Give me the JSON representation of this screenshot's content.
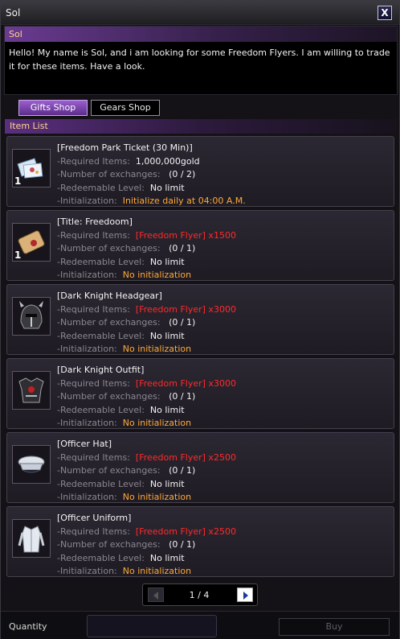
{
  "window": {
    "title": "Sol",
    "close_label": "X"
  },
  "npc": {
    "name": "Sol",
    "dialogue": "Hello! My name is Sol, and i am looking for some Freedom Flyers. I am willing to trade it for these items. Have a look."
  },
  "tabs": [
    {
      "label": "Gifts Shop",
      "active": true
    },
    {
      "label": "Gears Shop",
      "active": false
    }
  ],
  "item_list_header": "Item List",
  "field_labels": {
    "required": "-Required Items:",
    "exchanges": "-Number of exchanges:",
    "level": "-Redeemable Level:",
    "init": "-Initialization:"
  },
  "items": [
    {
      "name": "[Freedom Park Ticket (30 Min)]",
      "icon": "tickets-icon",
      "count": "1",
      "required": "1,000,000gold",
      "required_color": "#f2f2f2",
      "exchanges": "(0 / 2)",
      "level": "No limit",
      "init": "Initialize daily at 04:00 A.M."
    },
    {
      "name": "[Title: Freedoom]",
      "icon": "scroll-icon",
      "count": "1",
      "required": "[Freedom Flyer] x1500",
      "required_color": "#ff2a2a",
      "exchanges": "(0 / 1)",
      "level": "No limit",
      "init": "No initialization"
    },
    {
      "name": "[Dark Knight Headgear]",
      "icon": "helmet-icon",
      "count": "",
      "required": "[Freedom Flyer] x3000",
      "required_color": "#ff2a2a",
      "exchanges": "(0 / 1)",
      "level": "No limit",
      "init": "No initialization"
    },
    {
      "name": "[Dark Knight Outfit]",
      "icon": "armor-icon",
      "count": "",
      "required": "[Freedom Flyer] x3000",
      "required_color": "#ff2a2a",
      "exchanges": "(0 / 1)",
      "level": "No limit",
      "init": "No initialization"
    },
    {
      "name": "[Officer Hat]",
      "icon": "officer-hat-icon",
      "count": "",
      "required": "[Freedom Flyer] x2500",
      "required_color": "#ff2a2a",
      "exchanges": "(0 / 1)",
      "level": "No limit",
      "init": "No initialization"
    },
    {
      "name": "[Officer Uniform]",
      "icon": "uniform-icon",
      "count": "",
      "required": "[Freedom Flyer] x2500",
      "required_color": "#ff2a2a",
      "exchanges": "(0 / 1)",
      "level": "No limit",
      "init": "No initialization"
    }
  ],
  "pager": {
    "label": "1 / 4",
    "prev_icon": "prev-arrow-icon",
    "next_icon": "next-arrow-icon"
  },
  "footer": {
    "quantity_label": "Quantity",
    "quantity_value": "",
    "buy_label": "Buy"
  }
}
